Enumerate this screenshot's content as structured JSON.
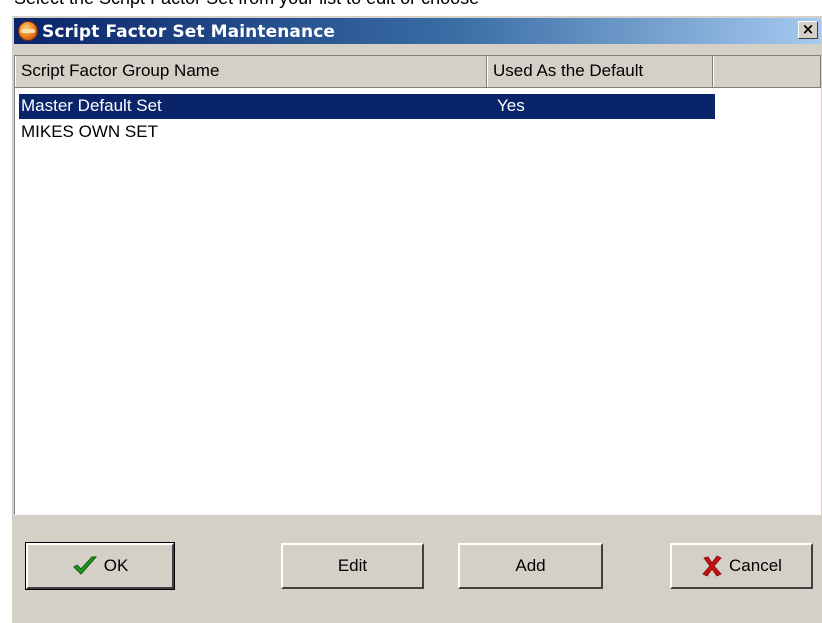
{
  "instruction_text": "Select the Script Factor Set from your list to edit or choose",
  "window": {
    "title": "Script Factor Set Maintenance",
    "close_label": "×"
  },
  "list": {
    "columns": [
      "Script Factor Group Name",
      "Used As the Default",
      ""
    ],
    "rows": [
      {
        "name": "Master Default Set",
        "default": "Yes",
        "selected": true
      },
      {
        "name": "MIKES OWN SET",
        "default": "",
        "selected": false
      }
    ],
    "selection_color": "#0a246a"
  },
  "buttons": {
    "ok_label": "OK",
    "edit_label": "Edit",
    "add_label": "Add",
    "cancel_label": "Cancel",
    "ok_icon": "check-icon",
    "cancel_icon": "x-icon"
  },
  "colors": {
    "titlebar_start": "#0a246a",
    "titlebar_end": "#a6caf0",
    "dialog_bg": "#d4d0c8",
    "check_green": "#1a9a1a",
    "cancel_red": "#cc1010"
  }
}
